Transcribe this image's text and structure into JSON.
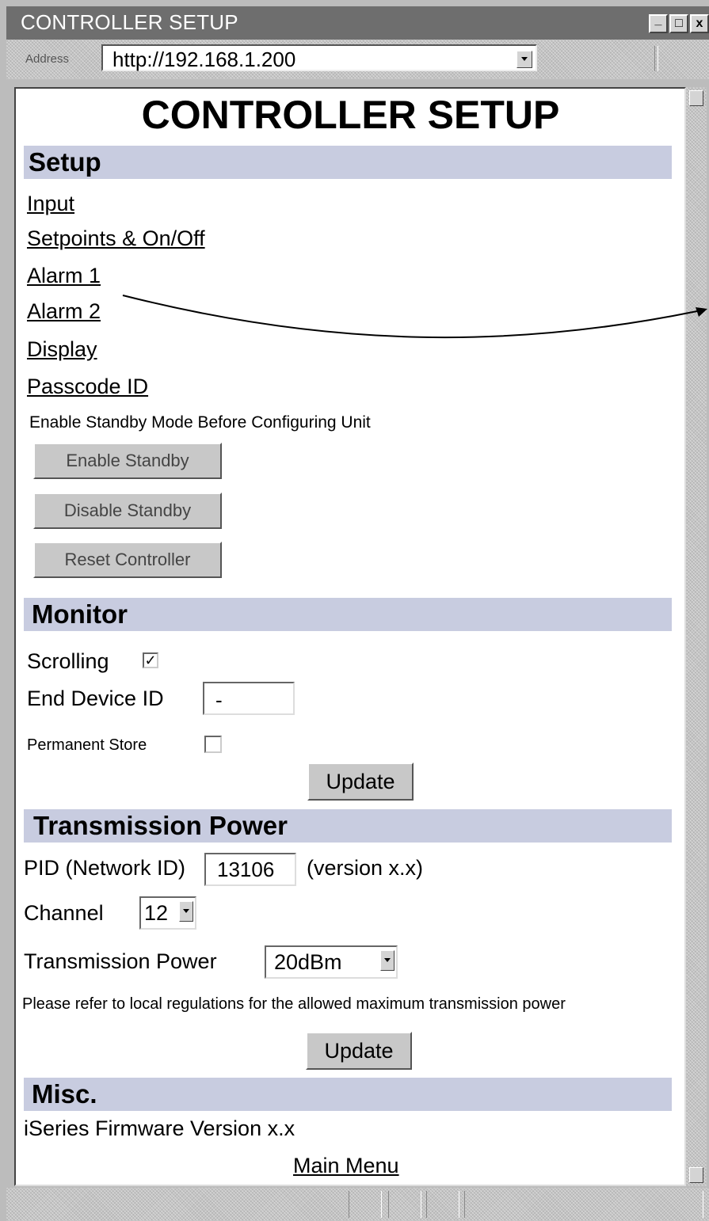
{
  "window": {
    "title": "CONTROLLER SETUP",
    "controls": {
      "minimize": "_",
      "maximize": "□",
      "close": "x"
    }
  },
  "address_bar": {
    "label": "Address",
    "url": "http://192.168.1.200"
  },
  "page": {
    "title": "CONTROLLER SETUP",
    "setup": {
      "heading": "Setup",
      "links": [
        "Input",
        "Setpoints & On/Off",
        "Alarm 1",
        "Alarm 2",
        "Display",
        "Passcode ID"
      ],
      "standby_note": "Enable Standby Mode Before Configuring Unit",
      "buttons": [
        "Enable Standby",
        "Disable Standby",
        "Reset Controller"
      ]
    },
    "monitor": {
      "heading": "Monitor",
      "scrolling_label": "Scrolling",
      "scrolling_checked": true,
      "end_device_label": "End Device ID",
      "end_device_value": "-",
      "permanent_store_label": "Permanent Store",
      "permanent_store_checked": false,
      "update_label": "Update"
    },
    "transmission": {
      "heading": "Transmission Power",
      "pid_label": "PID (Network ID)",
      "pid_value": "13106",
      "version": "(version x.x)",
      "channel_label": "Channel",
      "channel_value": "12",
      "power_label": "Transmission Power",
      "power_value": "20dBm",
      "note": "Please refer to local regulations for the allowed maximum transmission power",
      "update_label": "Update"
    },
    "misc": {
      "heading": "Misc.",
      "firmware": "iSeries Firmware Version x.x",
      "main_menu": "Main Menu"
    }
  },
  "icons": {
    "dropdown": "dropdown-arrow-icon",
    "checkbox_checked": "✓"
  }
}
